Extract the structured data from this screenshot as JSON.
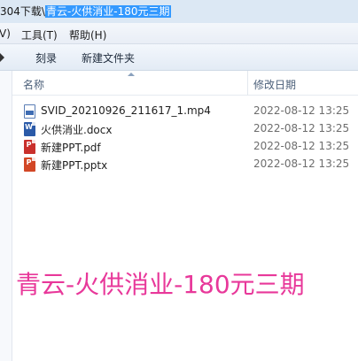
{
  "titlebar": {
    "path_prefix": "304下载\\",
    "path_selected": "青云-火供消业-180元三期"
  },
  "menubar": {
    "items": [
      "V)",
      "工具(T)",
      "帮助(H)"
    ]
  },
  "toolbar": {
    "burn_label": "刻录",
    "new_folder_label": "新建文件夹"
  },
  "columns": {
    "name": "名称",
    "modified": "修改日期"
  },
  "files": [
    {
      "name": "SVID_20210926_211617_1.mp4",
      "date": "2022-08-12 13:25",
      "icon": "video-file-icon"
    },
    {
      "name": "火供消业.docx",
      "date": "2022-08-12 13:25",
      "icon": "word-document-icon"
    },
    {
      "name": "新建PPT.pdf",
      "date": "2022-08-12 13:25",
      "icon": "pdf-file-icon"
    },
    {
      "name": "新建PPT.pptx",
      "date": "2022-08-12 13:25",
      "icon": "powerpoint-file-icon"
    }
  ],
  "watermark": "青云-火供消业-180元三期",
  "colors": {
    "selection": "#3399ff",
    "watermark": "#e8389a"
  }
}
